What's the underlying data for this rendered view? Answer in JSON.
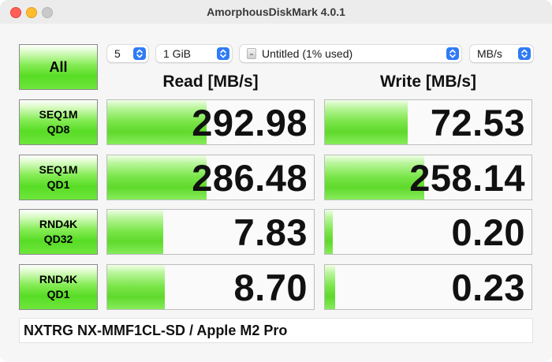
{
  "window": {
    "title": "AmorphousDiskMark 4.0.1"
  },
  "controls": {
    "all_label": "All",
    "count": "5",
    "size": "1 GiB",
    "drive": "Untitled (1% used)",
    "unit": "MB/s"
  },
  "headers": {
    "read": "Read [MB/s]",
    "write": "Write [MB/s]"
  },
  "tests": [
    {
      "line1": "SEQ1M",
      "line2": "QD8",
      "read": "292.98",
      "write": "72.53",
      "read_fill": 0.48,
      "write_fill": 0.4
    },
    {
      "line1": "SEQ1M",
      "line2": "QD1",
      "read": "286.48",
      "write": "258.14",
      "read_fill": 0.48,
      "write_fill": 0.48
    },
    {
      "line1": "RND4K",
      "line2": "QD32",
      "read": "7.83",
      "write": "0.20",
      "read_fill": 0.27,
      "write_fill": 0.04
    },
    {
      "line1": "RND4K",
      "line2": "QD1",
      "read": "8.70",
      "write": "0.23",
      "read_fill": 0.28,
      "write_fill": 0.05
    }
  ],
  "comment": "NXTRG NX-MMF1CL-SD / Apple M2 Pro",
  "colors": {
    "accent": "#2f7bf5",
    "bar_green": "#5fd92c"
  },
  "icons": {
    "close": "close-icon",
    "minimize": "minimize-icon",
    "zoom": "zoom-icon",
    "popup_chevron": "chevron-updown-icon",
    "drive": "drive-icon"
  }
}
